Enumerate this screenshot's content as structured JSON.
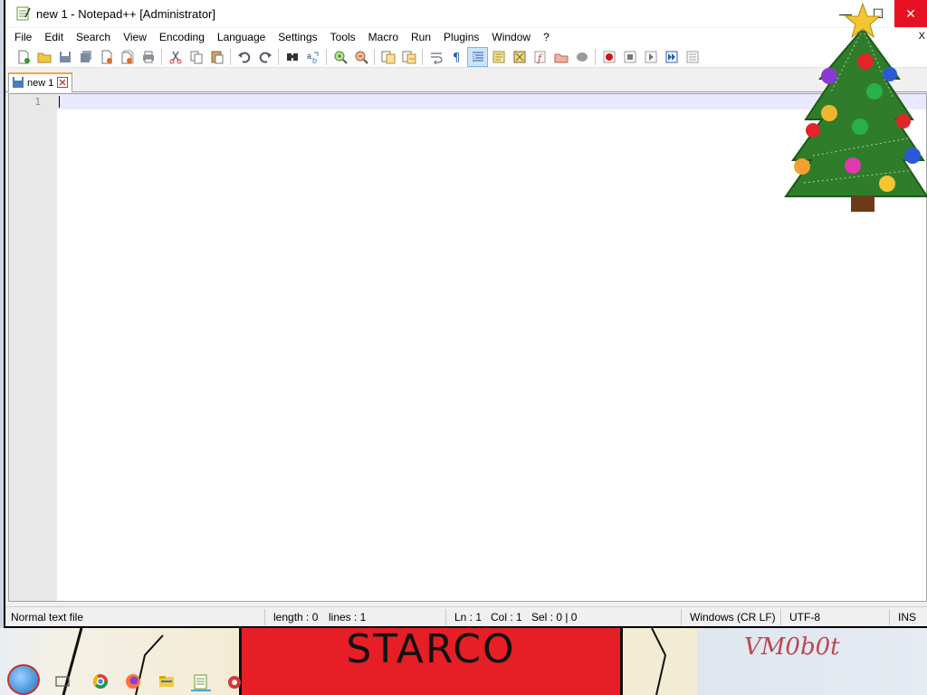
{
  "window": {
    "title": "new 1 - Notepad++ [Administrator]"
  },
  "menubar": {
    "items": [
      "File",
      "Edit",
      "Search",
      "View",
      "Encoding",
      "Language",
      "Settings",
      "Tools",
      "Macro",
      "Run",
      "Plugins",
      "Window",
      "?"
    ],
    "close_label": "X"
  },
  "toolbar": {
    "icons": [
      "new-file-icon",
      "open-file-icon",
      "save-icon",
      "save-all-icon",
      "close-icon",
      "close-all-icon",
      "print-icon",
      "cut-icon",
      "copy-icon",
      "paste-icon",
      "undo-icon",
      "redo-icon",
      "find-icon",
      "replace-icon",
      "zoom-in-icon",
      "zoom-out-icon",
      "sync-vertical-icon",
      "sync-horizontal-icon",
      "word-wrap-icon",
      "show-all-characters-icon",
      "indent-guide-icon",
      "user-defined-language-icon",
      "document-map-icon",
      "function-list-icon",
      "folder-as-workspace-icon",
      "monitoring-icon",
      "record-macro-icon",
      "stop-recording-icon",
      "playback-macro-icon",
      "run-macro-multiple-icon",
      "save-macro-icon"
    ]
  },
  "tabs": [
    {
      "label": "new 1"
    }
  ],
  "editor": {
    "line_numbers": [
      "1"
    ],
    "content": ""
  },
  "statusbar": {
    "file_type": "Normal text file",
    "length": "length : 0",
    "lines": "lines : 1",
    "ln": "Ln : 1",
    "col": "Col : 1",
    "sel": "Sel : 0 | 0",
    "eol": "Windows (CR LF)",
    "encoding": "UTF-8",
    "mode": "INS"
  },
  "desktop": {
    "wallpaper_text": "STARCO",
    "wallpaper_signature": "VM0b0t"
  },
  "taskbar": {
    "icons": [
      "start-icon",
      "task-view-icon",
      "chrome-icon",
      "firefox-icon",
      "file-explorer-icon",
      "notepadpp-icon",
      "app-icon"
    ]
  },
  "colors": {
    "close_button": "#e81123",
    "current_line": "#e8e8ff",
    "tab_accent": "#f6a440",
    "wallpaper_red": "#e51f25"
  }
}
